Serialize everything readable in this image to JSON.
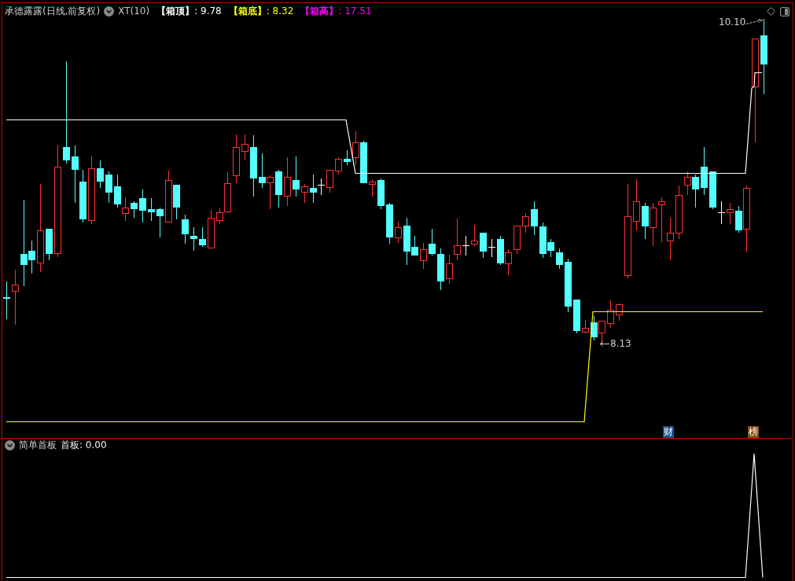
{
  "header": {
    "title": "承德露露(日线,前复权)",
    "indicator": "XT(10)",
    "readings": [
      {
        "text": "**【箱顶】**: 9.78",
        "color": "#ffffff"
      },
      {
        "text": "**【箱底】**: 8.32",
        "color": "#ffff00"
      },
      {
        "text": "**【箱高】**: 17.51",
        "color": "#ff00ff"
      }
    ]
  },
  "main_chart": {
    "annotations": [
      {
        "kind": "high",
        "text": "10.10"
      },
      {
        "kind": "low",
        "text": "8.13"
      }
    ],
    "tags": [
      {
        "text": "财",
        "color": "#1c4f8c"
      },
      {
        "text": "榜",
        "color": "#8b4a10"
      }
    ]
  },
  "sub_panel": {
    "title": "简单首板",
    "readings": [
      {
        "text": "首板: 0.00"
      }
    ]
  }
}
